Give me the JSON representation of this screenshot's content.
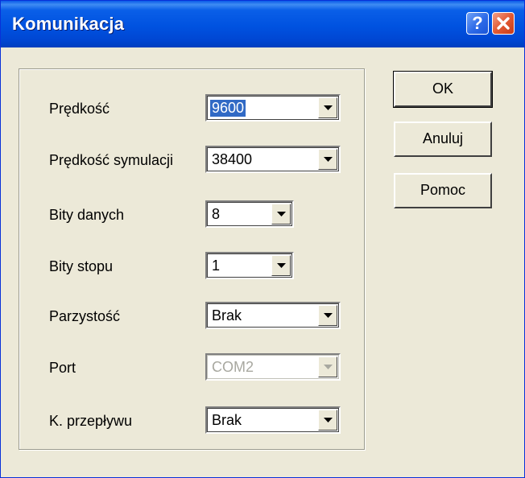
{
  "window": {
    "title": "Komunikacja",
    "help_icon": "question-mark",
    "close_icon": "x-mark"
  },
  "fields": [
    {
      "label": "Prędkość",
      "value": "9600",
      "selected": true,
      "enabled": true
    },
    {
      "label": "Prędkość symulacji",
      "value": "38400",
      "selected": false,
      "enabled": true
    },
    {
      "label": "Bity danych",
      "value": "8",
      "selected": false,
      "enabled": true
    },
    {
      "label": "Bity stopu",
      "value": "1",
      "selected": false,
      "enabled": true
    },
    {
      "label": "Parzystość",
      "value": "Brak",
      "selected": false,
      "enabled": true
    },
    {
      "label": "Port",
      "value": "COM2",
      "selected": false,
      "enabled": false
    },
    {
      "label": "K. przepływu",
      "value": "Brak",
      "selected": false,
      "enabled": true
    }
  ],
  "buttons": {
    "ok": "OK",
    "cancel": "Anuluj",
    "help": "Pomoc"
  },
  "colors": {
    "title_bar": "#0052e0",
    "selection": "#316ac5",
    "dialog_bg": "#ece9d8",
    "close_button": "#e35a33"
  }
}
